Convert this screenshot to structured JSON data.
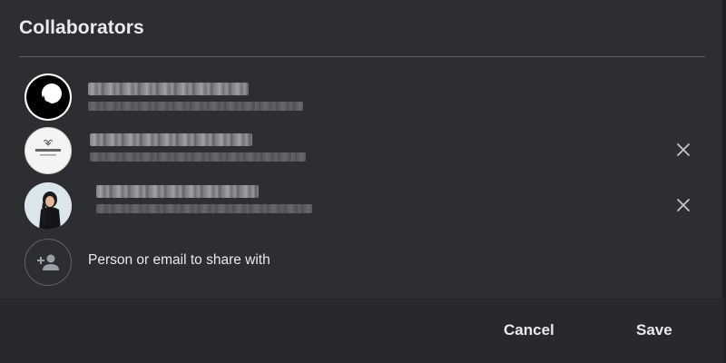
{
  "dialog": {
    "title": "Collaborators"
  },
  "collaborators": [
    {
      "avatar": "wolf-silhouette-avatar",
      "name": "██████ ████ █████",
      "email": "███████████████████████████████",
      "removable": false
    },
    {
      "avatar": "logo-avatar",
      "name": "██████ ████ █████",
      "email": "███████████████████████████████",
      "removable": true
    },
    {
      "avatar": "portrait-avatar",
      "name": "██████ ████ █████",
      "email": "███████████████████████████████",
      "removable": true
    }
  ],
  "share": {
    "placeholder": "Person or email to share with",
    "icon": "person-add-icon"
  },
  "footer": {
    "cancel_label": "Cancel",
    "save_label": "Save"
  },
  "colors": {
    "dialog_bg": "#2d2e31",
    "footer_bg": "#28292c",
    "text": "#e8eaed",
    "divider": "#5f6368"
  }
}
